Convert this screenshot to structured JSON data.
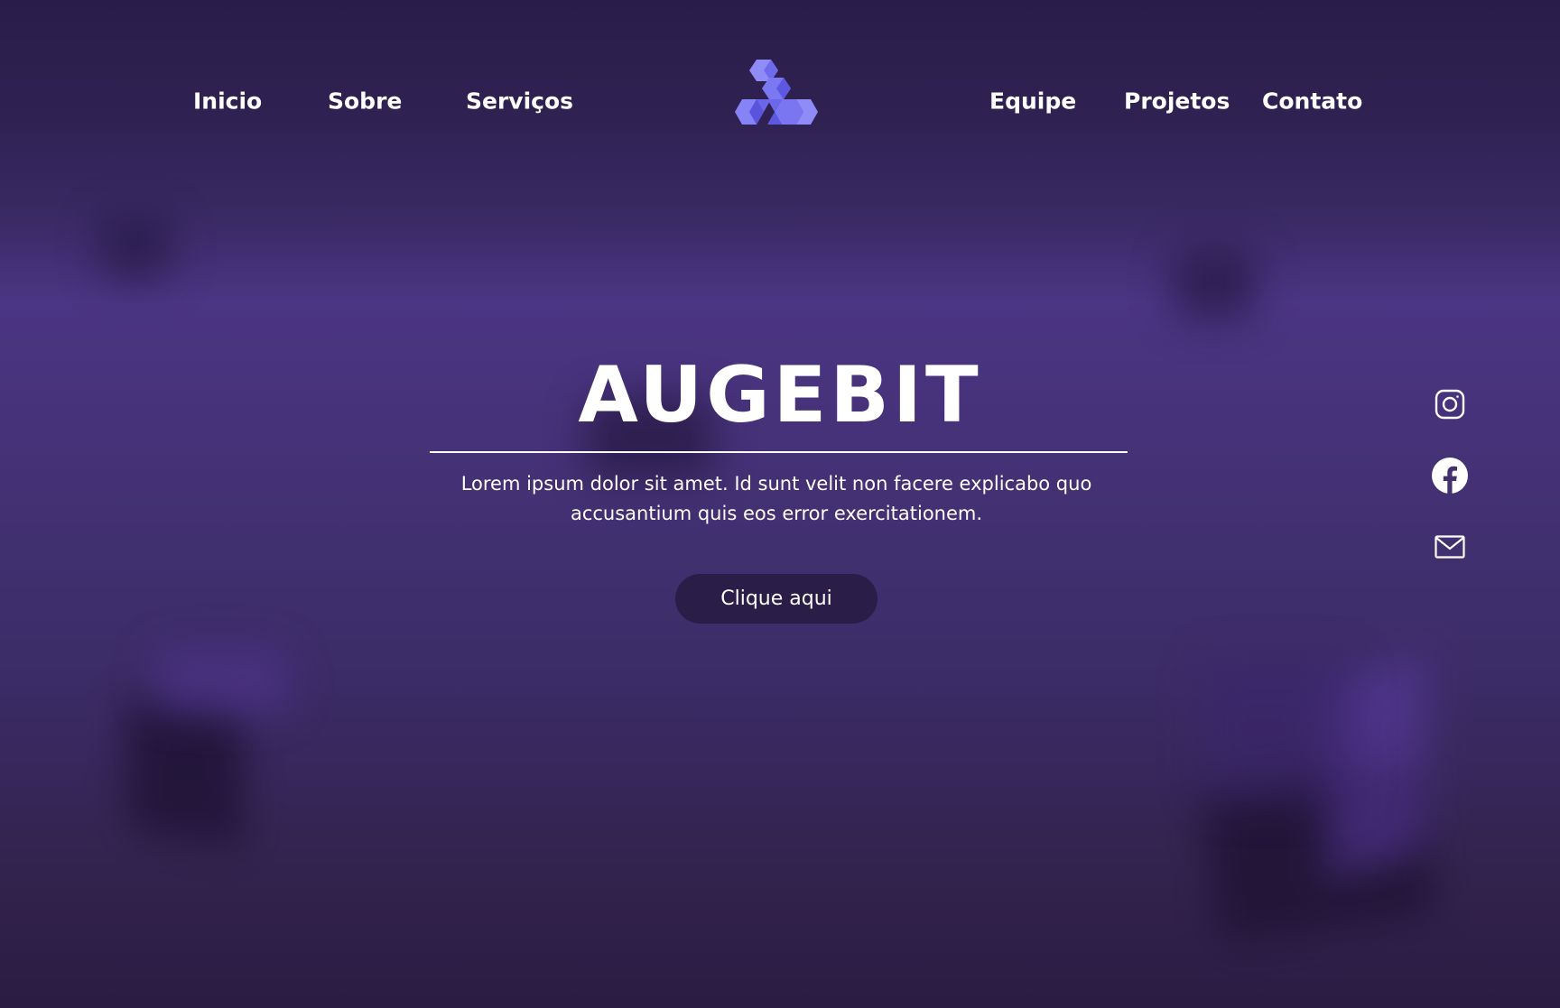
{
  "nav": {
    "left": [
      {
        "label": "Inicio"
      },
      {
        "label": "Sobre"
      },
      {
        "label": "Serviços"
      }
    ],
    "right": [
      {
        "label": "Equipe"
      },
      {
        "label": "Projetos"
      },
      {
        "label": "Contato"
      }
    ],
    "logo_icon": "stacked-cubes-logo-icon"
  },
  "hero": {
    "title": "AUGEBIT",
    "description": "Lorem ipsum dolor sit amet. Id sunt velit non facere explicabo quo accusantium quis eos error exercitationem.",
    "cta_label": "Clique aqui"
  },
  "social": [
    {
      "icon": "instagram-icon"
    },
    {
      "icon": "facebook-icon"
    },
    {
      "icon": "mail-icon"
    }
  ],
  "colors": {
    "background_top": "#2a1c4a",
    "background_mid": "#4b3584",
    "background_bottom": "#2b1c43",
    "logo_light": "#8f8cf8",
    "logo_dark": "#5e58e0",
    "button_bg": "#2a1d47",
    "text": "#ffffff"
  }
}
